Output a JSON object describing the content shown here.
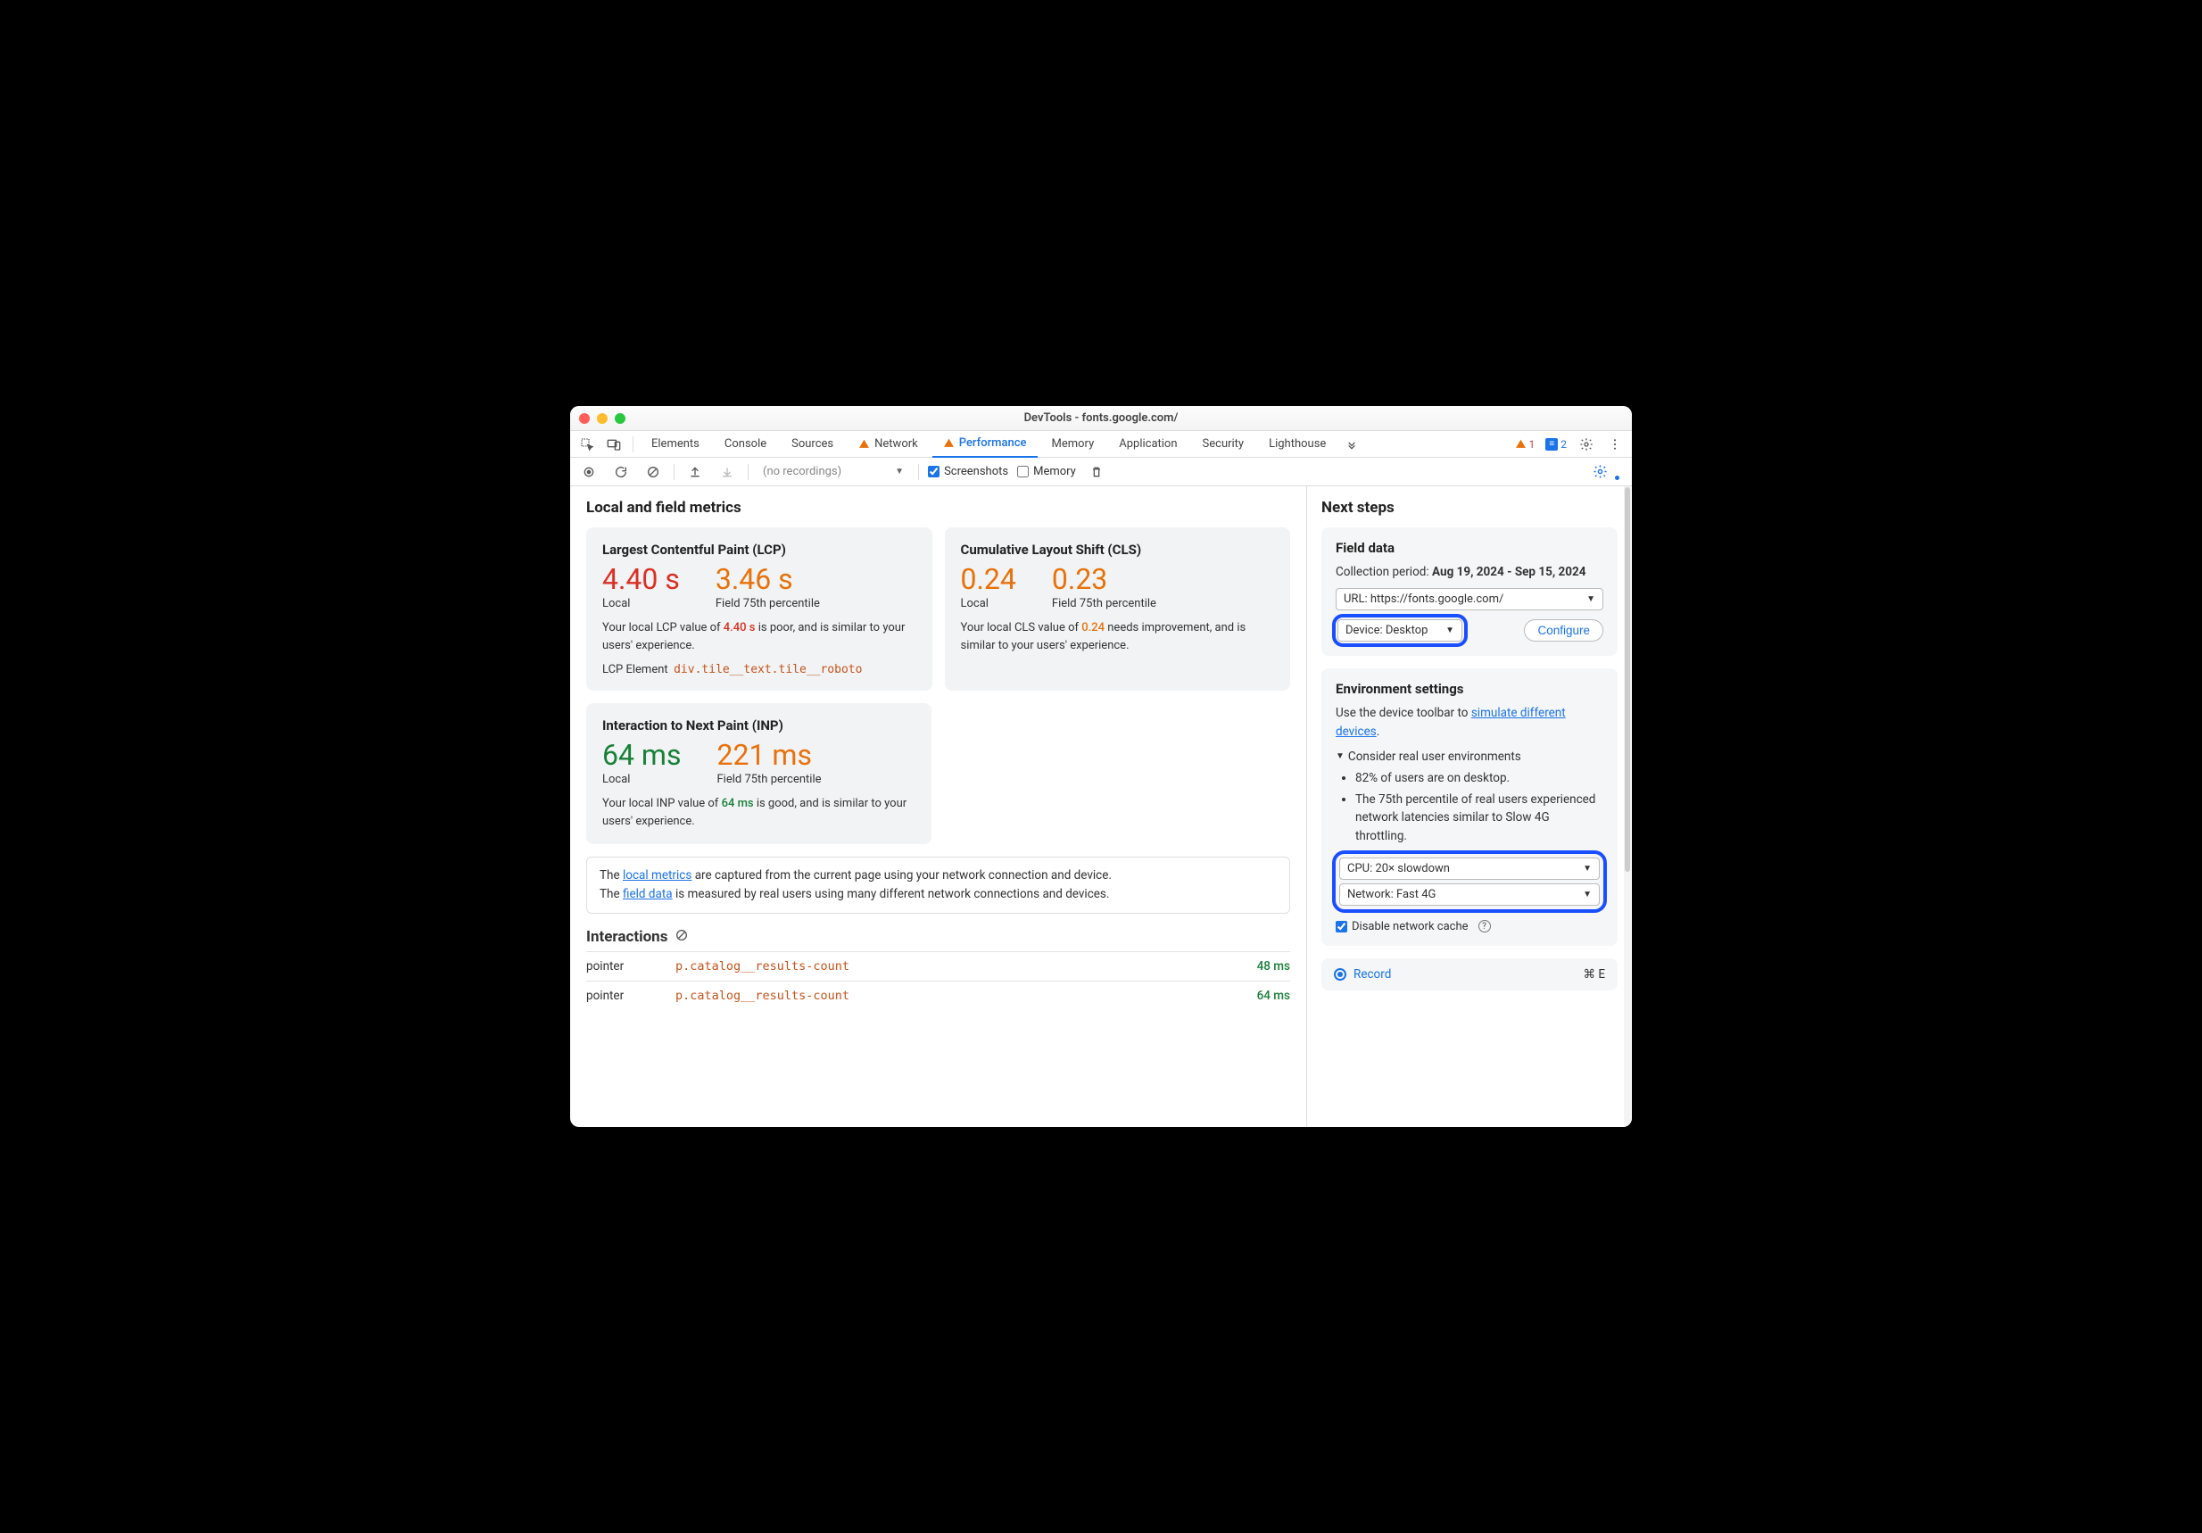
{
  "window": {
    "title": "DevTools - fonts.google.com/"
  },
  "tabs": {
    "elements": "Elements",
    "console": "Console",
    "sources": "Sources",
    "network": "Network",
    "performance": "Performance",
    "memory": "Memory",
    "application": "Application",
    "security": "Security",
    "lighthouse": "Lighthouse"
  },
  "badges": {
    "warn_count": "1",
    "info_count": "2"
  },
  "subtoolbar": {
    "recordings_placeholder": "(no recordings)",
    "screenshots": "Screenshots",
    "memory": "Memory"
  },
  "metrics_header": "Local and field metrics",
  "lcp": {
    "title": "Largest Contentful Paint (LCP)",
    "local_val": "4.40 s",
    "local_lbl": "Local",
    "field_val": "3.46 s",
    "field_lbl": "Field 75th percentile",
    "desc_a": "Your local LCP value of ",
    "desc_b": "4.40 s",
    "desc_c": " is poor, and is similar to your users' experience.",
    "el_label": "LCP Element",
    "el_selector": "div.tile__text.tile__roboto"
  },
  "cls": {
    "title": "Cumulative Layout Shift (CLS)",
    "local_val": "0.24",
    "local_lbl": "Local",
    "field_val": "0.23",
    "field_lbl": "Field 75th percentile",
    "desc_a": "Your local CLS value of ",
    "desc_b": "0.24",
    "desc_c": " needs improvement, and is similar to your users' experience."
  },
  "inp": {
    "title": "Interaction to Next Paint (INP)",
    "local_val": "64 ms",
    "local_lbl": "Local",
    "field_val": "221 ms",
    "field_lbl": "Field 75th percentile",
    "desc_a": "Your local INP value of ",
    "desc_b": "64 ms",
    "desc_c": " is good, and is similar to your users' experience."
  },
  "note": {
    "pre1": "The ",
    "link1": "local metrics",
    "post1": " are captured from the current page using your network connection and device.",
    "pre2": "The ",
    "link2": "field data",
    "post2": " is measured by real users using many different network connections and devices."
  },
  "interactions": {
    "title": "Interactions",
    "rows": [
      {
        "type": "pointer",
        "selector": "p.catalog__results-count",
        "time": "48 ms"
      },
      {
        "type": "pointer",
        "selector": "p.catalog__results-count",
        "time": "64 ms"
      }
    ]
  },
  "next": {
    "title": "Next steps",
    "field": {
      "title": "Field data",
      "period_lbl": "Collection period: ",
      "period_val": "Aug 19, 2024 - Sep 15, 2024",
      "url_text": "URL: https://fonts.google.com/",
      "device_text": "Device: Desktop",
      "configure": "Configure"
    },
    "env": {
      "title": "Environment settings",
      "hint_a": "Use the device toolbar to ",
      "hint_link": "simulate different devices",
      "hint_b": ".",
      "consider": "Consider real user environments",
      "bullet1": "82% of users are on desktop.",
      "bullet2": "The 75th percentile of real users experienced network latencies similar to Slow 4G throttling.",
      "cpu_text": "CPU: 20× slowdown",
      "net_text": "Network: Fast 4G",
      "disable_cache": "Disable network cache"
    },
    "record": {
      "label": "Record",
      "shortcut": "⌘ E"
    }
  }
}
